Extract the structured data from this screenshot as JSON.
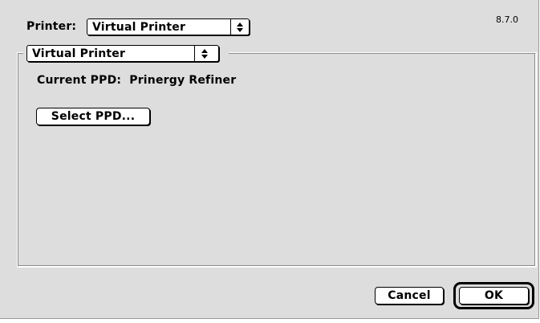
{
  "printer": {
    "label": "Printer:",
    "selected": "Virtual Printer"
  },
  "version": "8.7.0",
  "panel": {
    "selected": "Virtual Printer"
  },
  "current_ppd": {
    "label": "Current PPD:",
    "value": "Prinergy Refiner"
  },
  "buttons": {
    "select_ppd": "Select PPD...",
    "cancel": "Cancel",
    "ok": "OK"
  },
  "icons": {
    "popup_arrows": "up-down-arrows-icon"
  }
}
